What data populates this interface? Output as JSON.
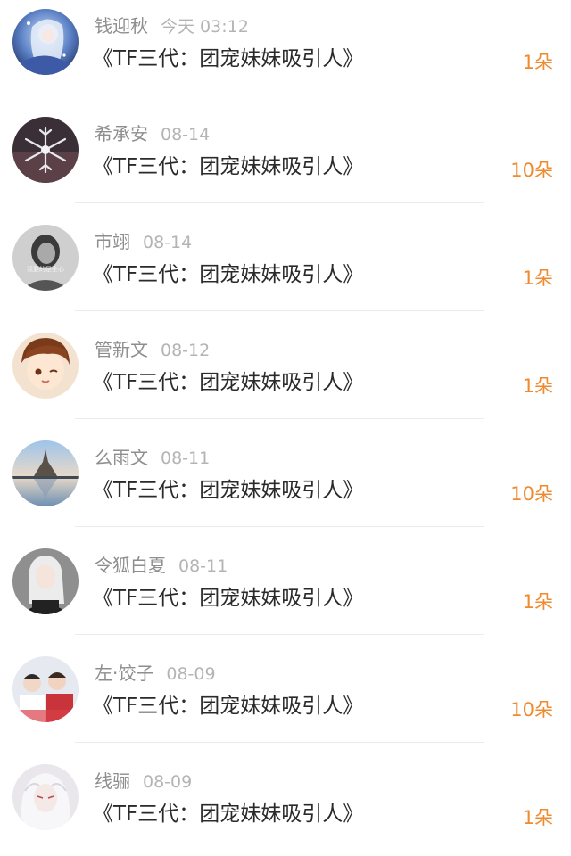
{
  "rows": [
    {
      "name": "钱迎秋",
      "date": "今天 03:12",
      "title": "《TF三代：团宠妹妹吸引人》",
      "count": "1朵"
    },
    {
      "name": "希承安",
      "date": "08-14",
      "title": "《TF三代：团宠妹妹吸引人》",
      "count": "10朵"
    },
    {
      "name": "市翊",
      "date": "08-14",
      "title": "《TF三代：团宠妹妹吸引人》",
      "count": "1朵"
    },
    {
      "name": "管新文",
      "date": "08-12",
      "title": "《TF三代：团宠妹妹吸引人》",
      "count": "1朵"
    },
    {
      "name": "么雨文",
      "date": "08-11",
      "title": "《TF三代：团宠妹妹吸引人》",
      "count": "10朵"
    },
    {
      "name": "令狐白夏",
      "date": "08-11",
      "title": "《TF三代：团宠妹妹吸引人》",
      "count": "1朵"
    },
    {
      "name": "左·饺子",
      "date": "08-09",
      "title": "《TF三代：团宠妹妹吸引人》",
      "count": "10朵"
    },
    {
      "name": "线骊",
      "date": "08-09",
      "title": "《TF三代：团宠妹妹吸引人》",
      "count": "1朵"
    }
  ],
  "avatar_overlay_text": {
    "row_2": "我要的是全心"
  },
  "colors": {
    "name": "#8e8e8e",
    "date": "#b4b4b4",
    "title": "#2a2a2a",
    "count_accent": "#f08a2e",
    "divider": "#ececec"
  }
}
